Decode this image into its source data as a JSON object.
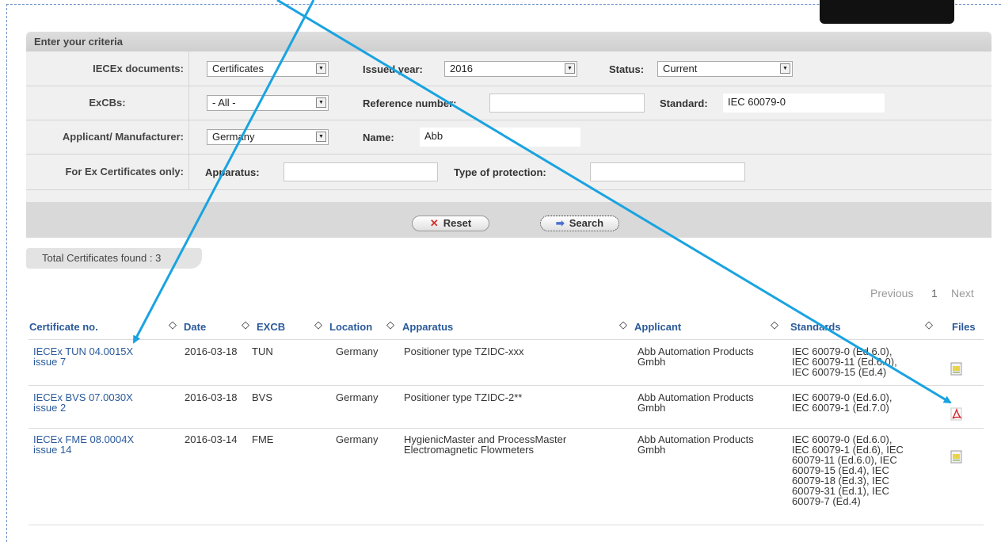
{
  "panel": {
    "title": "Enter your criteria"
  },
  "criteria": {
    "iecex_docs": {
      "label": "IECEx documents:",
      "value": "Certificates"
    },
    "issued_year": {
      "label": "Issued year:",
      "value": "2016"
    },
    "status": {
      "label": "Status:",
      "value": "Current"
    },
    "excbs": {
      "label": "ExCBs:",
      "value": "- All -"
    },
    "reference_number": {
      "label": "Reference number:",
      "value": ""
    },
    "standard": {
      "label": "Standard:",
      "value": "IEC 60079-0"
    },
    "applicant": {
      "label": "Applicant/ Manufacturer:",
      "value": "Germany"
    },
    "name": {
      "label": "Name:",
      "value": "Abb"
    },
    "ex_only": {
      "label": "For Ex Certificates only:"
    },
    "apparatus": {
      "label": "Apparatus:",
      "value": ""
    },
    "type_of_protection": {
      "label": "Type of protection:",
      "value": ""
    }
  },
  "buttons": {
    "reset": "Reset",
    "search": "Search"
  },
  "total": "Total Certificates found : 3",
  "pager": {
    "previous": "Previous",
    "page": "1",
    "next": "Next"
  },
  "table": {
    "headers": {
      "certificate": "Certificate no.",
      "date": "Date",
      "excb": "EXCB",
      "location": "Location",
      "apparatus": "Apparatus",
      "applicant": "Applicant",
      "standards": "Standards",
      "files": "Files"
    },
    "sort_glyph": "◇",
    "rows": [
      {
        "cert": [
          "IECEx TUN 04.0015X",
          "issue 7"
        ],
        "date": "2016-03-18",
        "excb": "TUN",
        "location": "Germany",
        "apparatus": [
          "Positioner type TZIDC-xxx"
        ],
        "applicant": [
          "Abb Automation Products",
          "Gmbh"
        ],
        "standards": [
          "IEC 60079-0 (Ed.6.0),",
          "IEC 60079-11 (Ed.6.0),",
          "IEC 60079-15 (Ed.4)"
        ],
        "file": "document-icon"
      },
      {
        "cert": [
          "IECEx BVS 07.0030X",
          "issue 2"
        ],
        "date": "2016-03-18",
        "excb": "BVS",
        "location": "Germany",
        "apparatus": [
          "Positioner type TZIDC-2**"
        ],
        "applicant": [
          "Abb Automation Products",
          "Gmbh"
        ],
        "standards": [
          "IEC 60079-0 (Ed.6.0),",
          "IEC 60079-1 (Ed.7.0)"
        ],
        "file": "pdf-icon"
      },
      {
        "cert": [
          "IECEx FME 08.0004X",
          "issue 14"
        ],
        "date": "2016-03-14",
        "excb": "FME",
        "location": "Germany",
        "apparatus": [
          "HygienicMaster and ProcessMaster",
          "Electromagnetic Flowmeters"
        ],
        "applicant": [
          "Abb Automation Products",
          "Gmbh"
        ],
        "standards": [
          "IEC 60079-0 (Ed.6.0),",
          "IEC 60079-1 (Ed.6), IEC",
          "60079-11 (Ed.6.0), IEC",
          "60079-15 (Ed.4), IEC",
          "60079-18 (Ed.3), IEC",
          "60079-31 (Ed.1), IEC",
          "60079-7 (Ed.4)"
        ],
        "file": "document-icon"
      }
    ]
  },
  "colors": {
    "link": "#2a5a9a",
    "annotation_arrow": "#1aa3e0"
  }
}
